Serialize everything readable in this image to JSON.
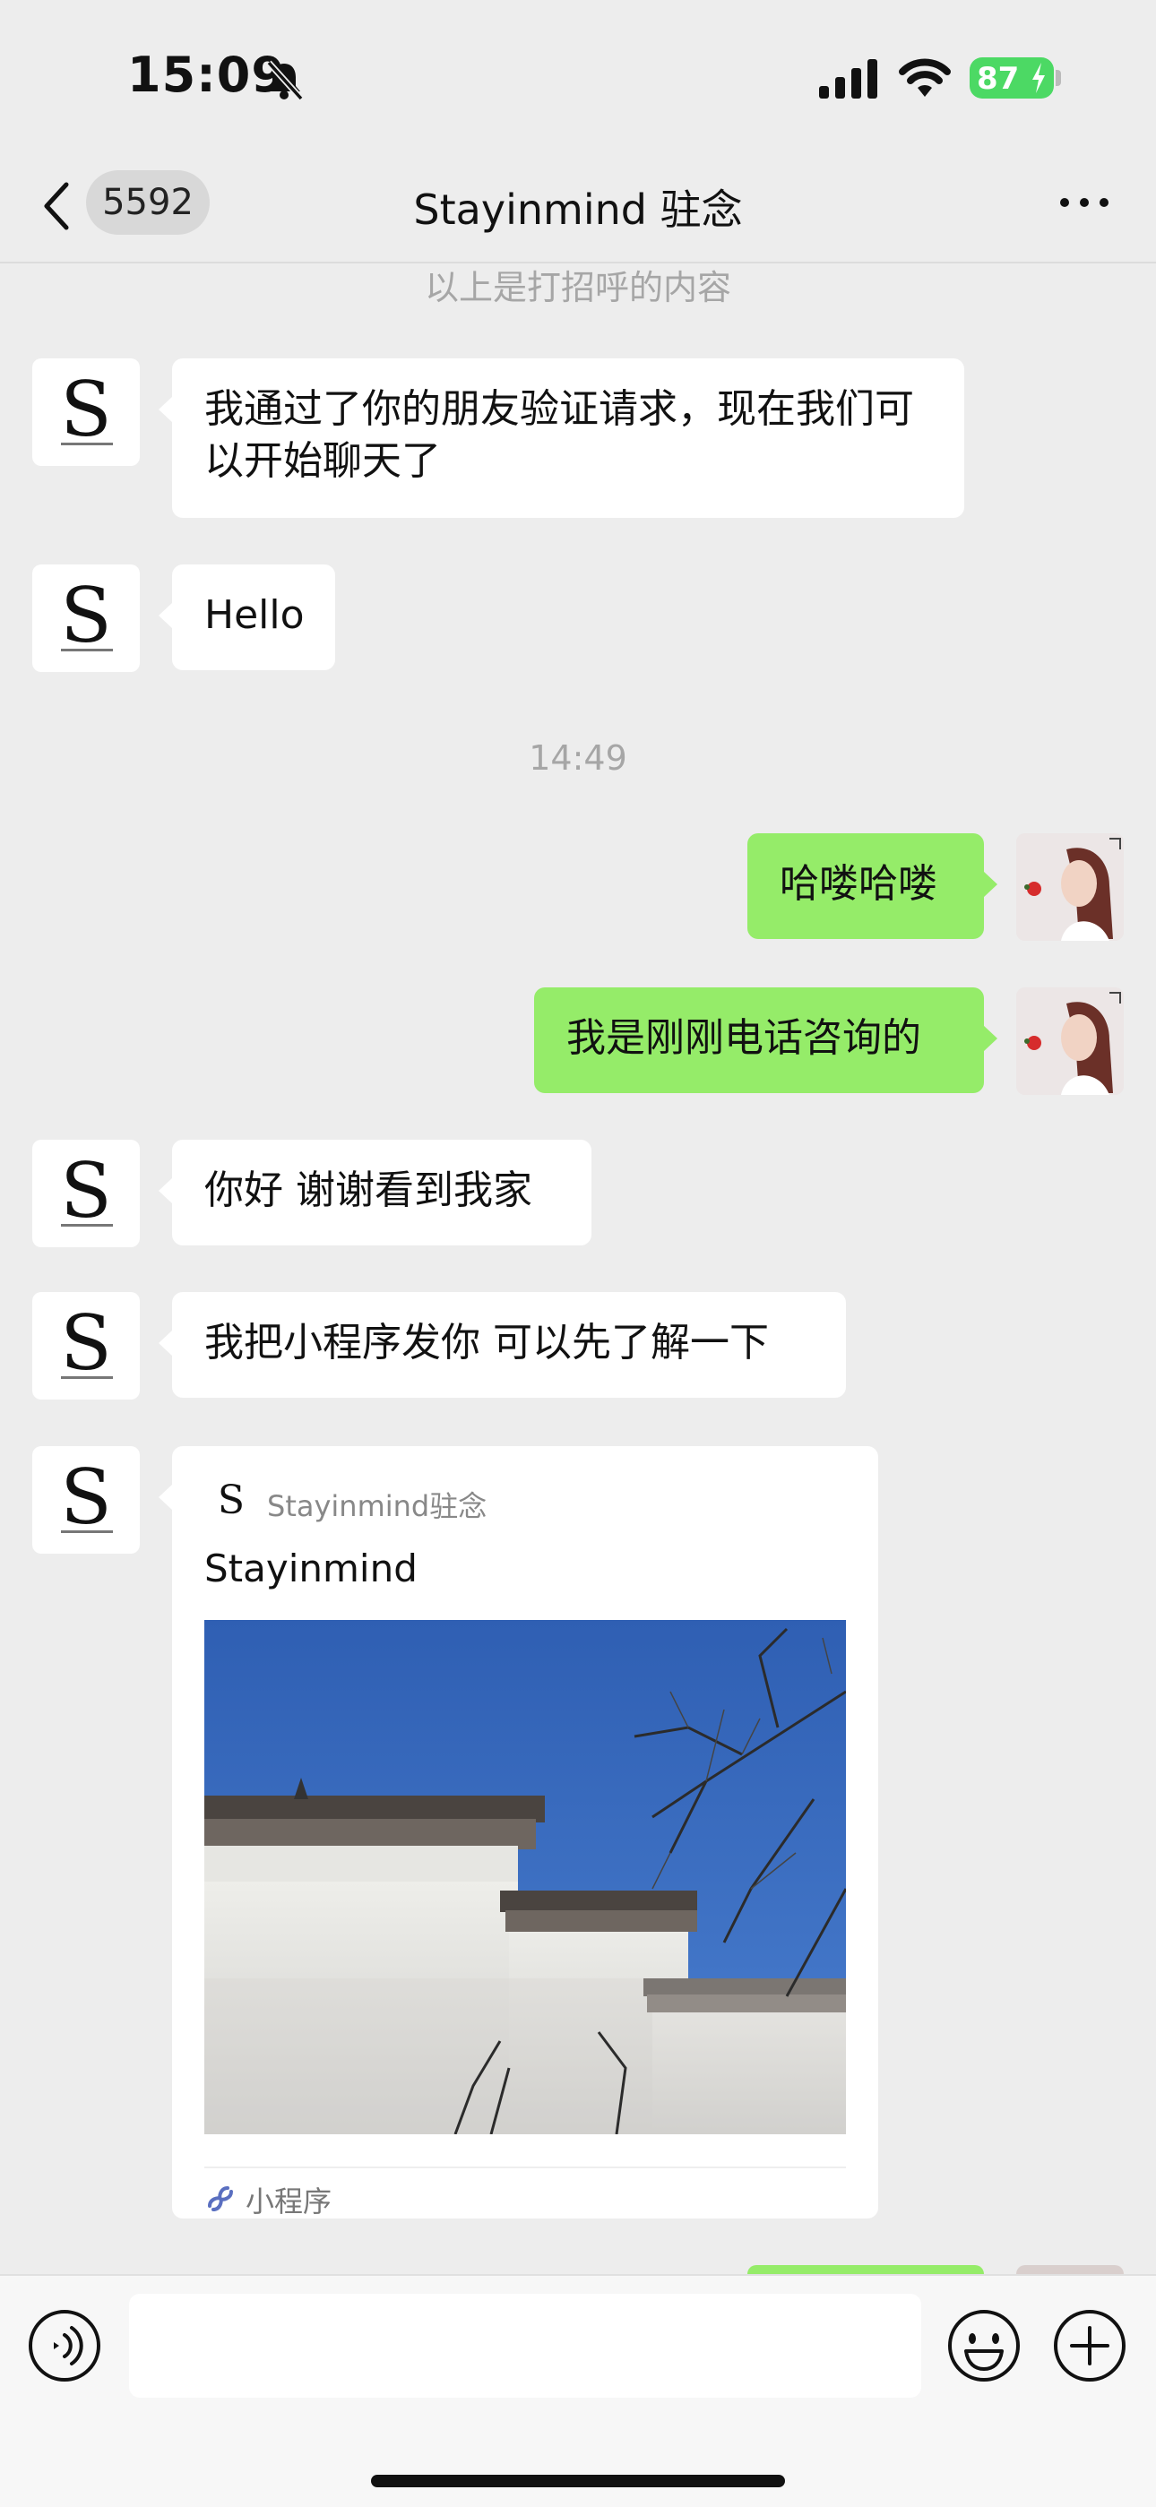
{
  "status_bar": {
    "time": "15:09",
    "battery": "87",
    "icons": [
      "bell-muted-icon",
      "signal-icon",
      "wifi-icon",
      "battery-charging-icon"
    ]
  },
  "nav": {
    "back_icon": "chevron-left-icon",
    "unread_count": "5592",
    "title": "Stayinmind 驻念",
    "more_icon": "more-icon"
  },
  "system_notice": "以上是打招呼的内容",
  "messages": [
    {
      "side": "in",
      "text": "我通过了你的朋友验证请求，现在我们可以开始聊天了"
    },
    {
      "side": "in",
      "text": "Hello"
    },
    {
      "type": "time",
      "text": "14:49"
    },
    {
      "side": "out",
      "text": "哈喽哈喽"
    },
    {
      "side": "out",
      "text": "我是刚刚电话咨询的"
    },
    {
      "side": "in",
      "text": "你好 谢谢看到我家"
    },
    {
      "side": "in",
      "text": "我把小程序发你 可以先了解一下"
    }
  ],
  "contact_avatar_letter": "S",
  "mini_program": {
    "app_name": "Stayinmind驻念",
    "title": "Stayinmind",
    "footer_label": "小程序",
    "footer_icon": "mini-program-link-icon"
  },
  "input_bar": {
    "value": "",
    "icons": [
      "voice-icon",
      "emoji-icon",
      "plus-icon"
    ]
  },
  "colors": {
    "background": "#ededed",
    "incoming_bubble": "#ffffff",
    "outgoing_bubble": "#95ec69",
    "battery": "#4cd964"
  }
}
